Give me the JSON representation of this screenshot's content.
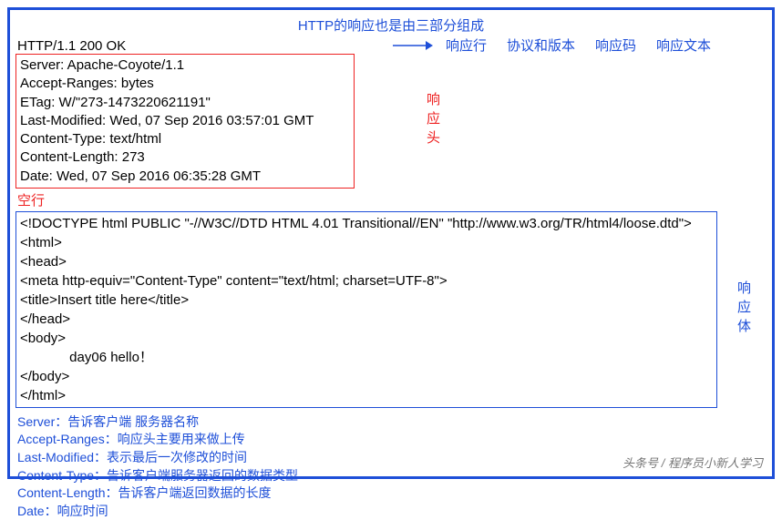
{
  "title": "HTTP的响应也是由三部分组成",
  "status_line": "HTTP/1.1 200 OK",
  "status_labels": [
    "响应行",
    "协议和版本",
    "响应码",
    "响应文本"
  ],
  "headers": [
    "Server: Apache-Coyote/1.1",
    "Accept-Ranges: bytes",
    "ETag: W/\"273-1473220621191\"",
    "Last-Modified: Wed, 07 Sep 2016 03:57:01 GMT",
    "Content-Type: text/html",
    "Content-Length: 273",
    "Date: Wed, 07 Sep 2016 06:35:28 GMT"
  ],
  "headers_label": "响应头",
  "blank_line_label": "空行",
  "body_lines": [
    "<!DOCTYPE html PUBLIC \"-//W3C//DTD HTML 4.01 Transitional//EN\" \"http://www.w3.org/TR/html4/loose.dtd\">",
    "<html>",
    "<head>",
    "<meta http-equiv=\"Content-Type\" content=\"text/html; charset=UTF-8\">",
    "<title>Insert title here</title>",
    "</head>",
    "<body>",
    "             day06 hello！",
    "</body>",
    "</html>"
  ],
  "body_label": "响应体",
  "explanations": [
    "Server：告诉客户端  服务器名称",
    "Accept-Ranges：响应头主要用来做上传",
    "Last-Modified：表示最后一次修改的时间",
    "Content-Type：告诉客户端服务器返回的数据类型",
    "Content-Length：告诉客户端返回数据的长度",
    "Date：响应时间"
  ],
  "watermark": "头条号 / 程序员小新人学习"
}
